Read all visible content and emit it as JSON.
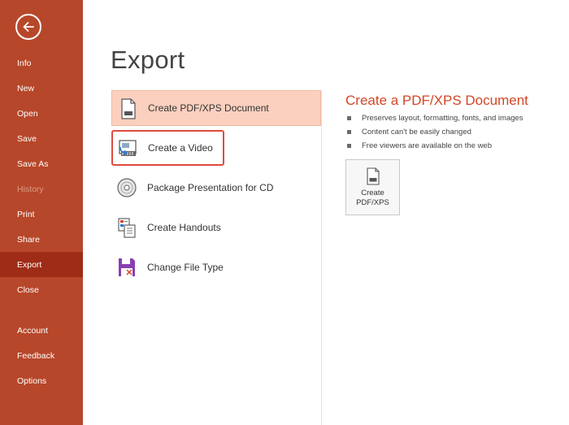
{
  "sidebar": {
    "items": [
      {
        "label": "Info"
      },
      {
        "label": "New"
      },
      {
        "label": "Open"
      },
      {
        "label": "Save"
      },
      {
        "label": "Save As"
      },
      {
        "label": "History",
        "disabled": true
      },
      {
        "label": "Print"
      },
      {
        "label": "Share"
      },
      {
        "label": "Export",
        "active": true
      },
      {
        "label": "Close"
      },
      {
        "label": "Account"
      },
      {
        "label": "Feedback"
      },
      {
        "label": "Options"
      }
    ]
  },
  "main": {
    "title": "Export",
    "options": [
      {
        "label": "Create PDF/XPS Document",
        "icon": "pdf-document-icon",
        "selected": true
      },
      {
        "label": "Create a Video",
        "icon": "video-icon",
        "highlighted": true
      },
      {
        "label": "Package Presentation for CD",
        "icon": "cd-icon"
      },
      {
        "label": "Create Handouts",
        "icon": "handouts-icon"
      },
      {
        "label": "Change File Type",
        "icon": "file-type-icon"
      }
    ]
  },
  "detail": {
    "title": "Create a PDF/XPS Document",
    "bullets": [
      "Preserves layout, formatting, fonts, and images",
      "Content can't be easily changed",
      "Free viewers are available on the web"
    ],
    "button_label": "Create\nPDF/XPS"
  },
  "colors": {
    "sidebar_bg": "#b7472a",
    "sidebar_active": "#9e2c17",
    "accent": "#d24726",
    "selected_bg": "#fcd0bf",
    "highlight_border": "#e04a3f"
  }
}
